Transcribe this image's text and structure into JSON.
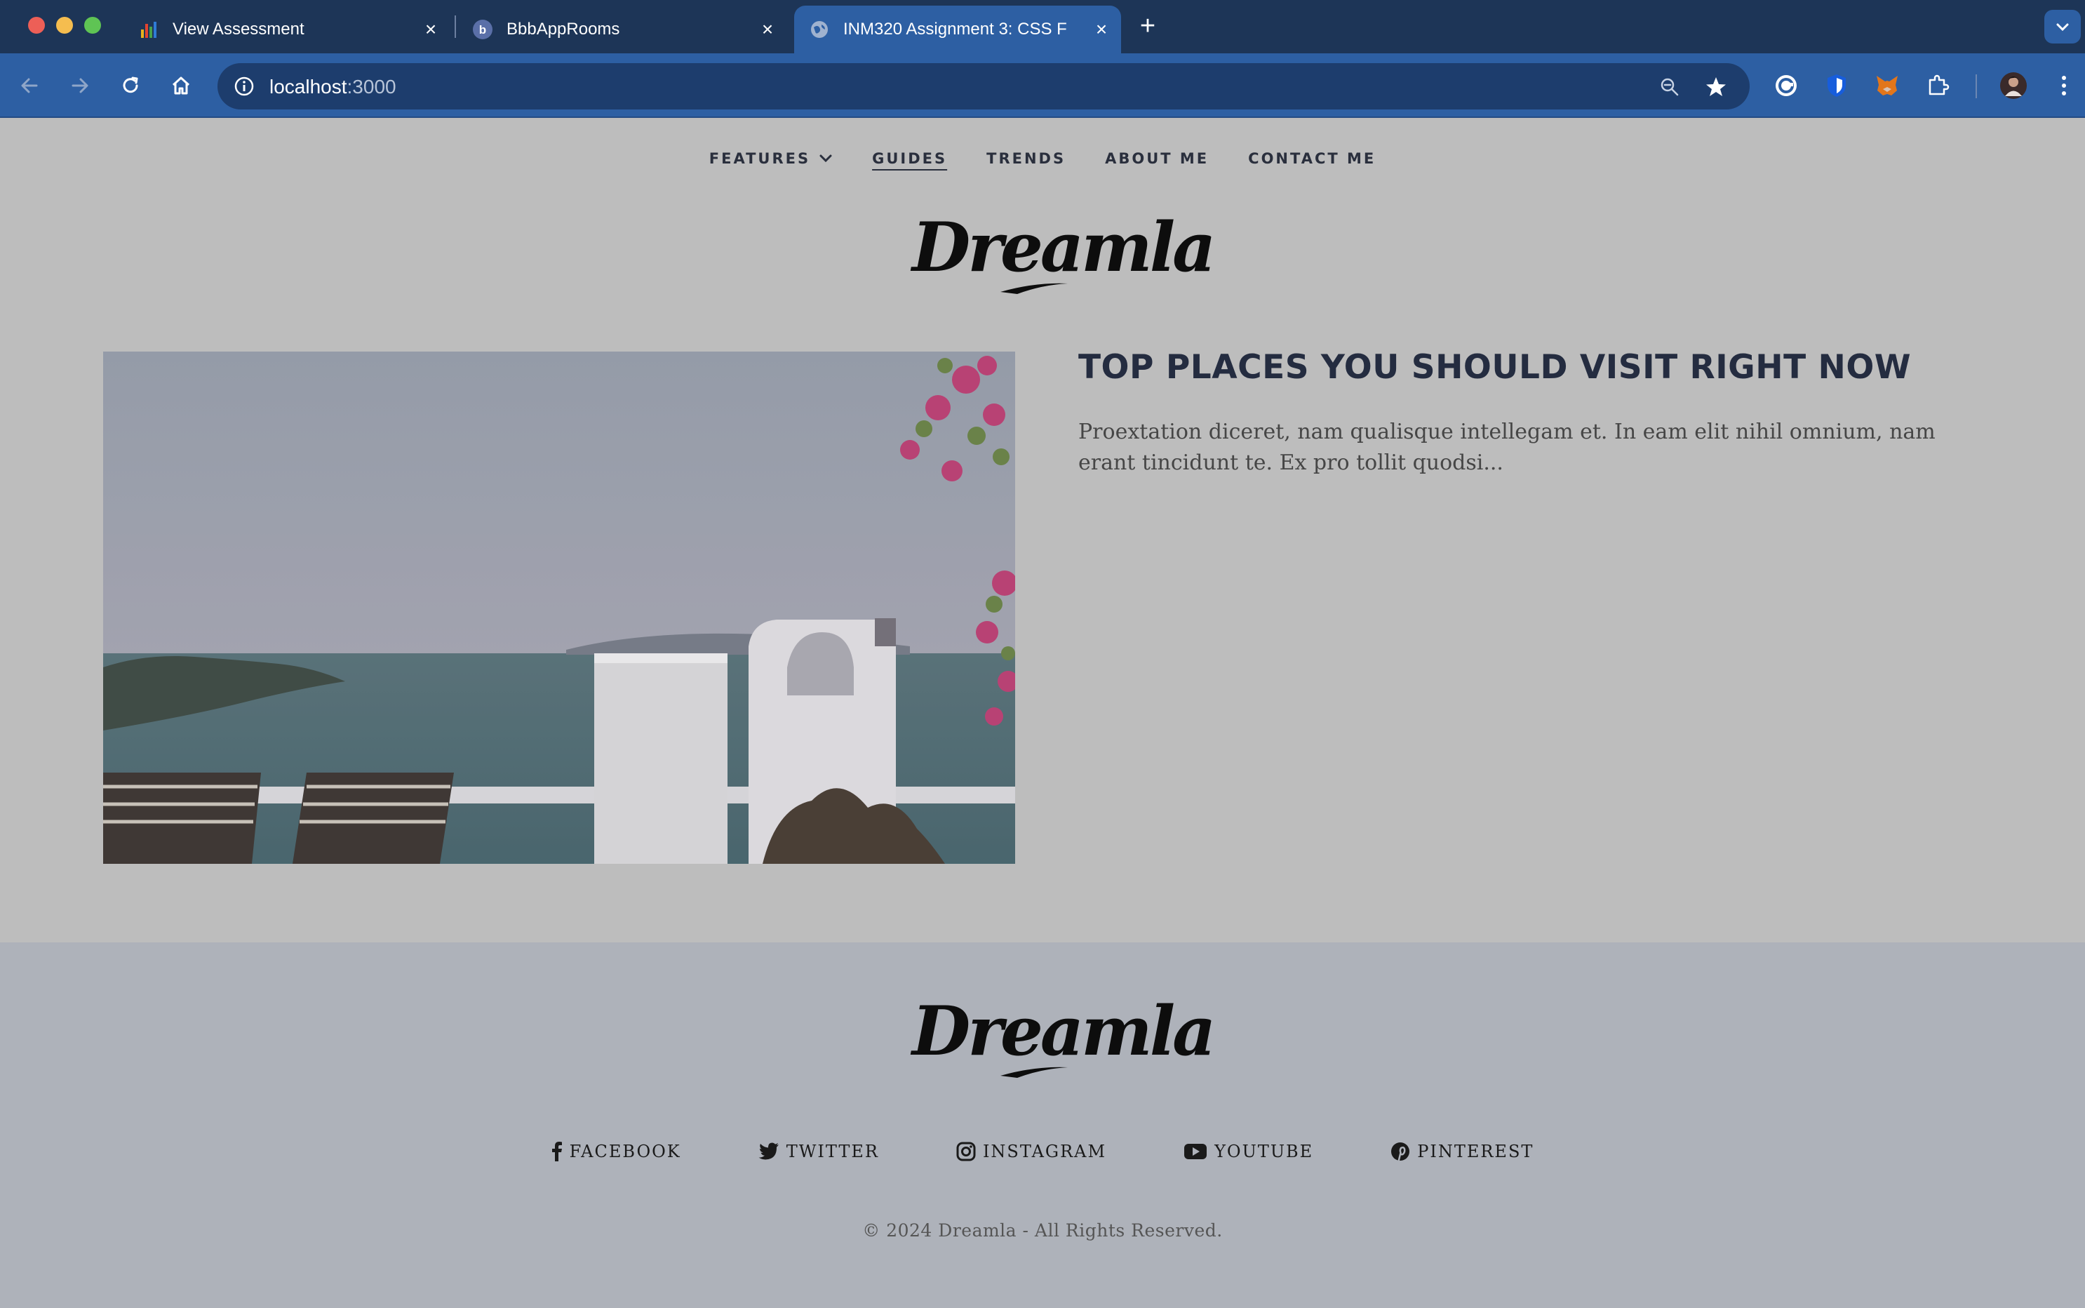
{
  "browser": {
    "tabs": [
      {
        "title": "View Assessment",
        "favicon": "bar-chart-icon"
      },
      {
        "title": "BbbAppRooms",
        "favicon": "b-logo-icon"
      },
      {
        "title": "INM320 Assignment 3: CSS F",
        "favicon": "globe-icon",
        "active": true
      }
    ],
    "address": {
      "host": "localhost",
      "port": ":3000"
    }
  },
  "nav": {
    "features": "FEATURES",
    "guides": "GUIDES",
    "trends": "TRENDS",
    "about": "ABOUT ME",
    "contact": "CONTACT ME"
  },
  "brand": {
    "logo": "Dreamla"
  },
  "post": {
    "title": "TOP PLACES YOU SHOULD VISIT RIGHT NOW",
    "excerpt": "Proextation diceret, nam qualisque intellegam et. In eam elit nihil omnium, nam erant tincidunt te. Ex pro tollit quodsi..."
  },
  "footer": {
    "social": {
      "facebook": "FACEBOOK",
      "twitter": "TWITTER",
      "instagram": "INSTAGRAM",
      "youtube": "YOUTUBE",
      "pinterest": "PINTEREST"
    },
    "copyright": "© 2024 Dreamla - All Rights Reserved."
  },
  "colors": {
    "tabstrip": "#1d3557",
    "toolbar": "#2d5fa3",
    "page_bg": "#bdbdbd",
    "footer_bg": "#aeb2ba",
    "heading": "#242c40"
  }
}
